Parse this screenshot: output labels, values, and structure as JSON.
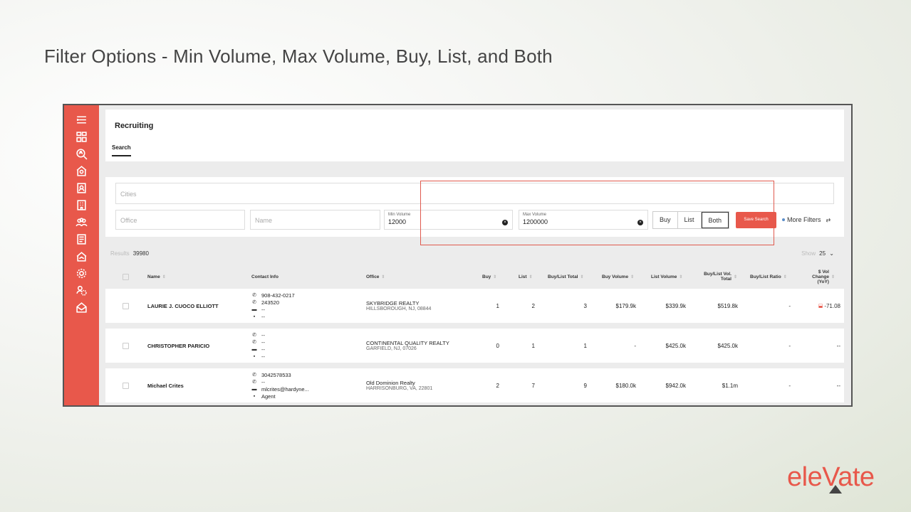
{
  "slide_title": "Filter Options - Min Volume, Max Volume, Buy, List, and Both",
  "sidebar": {
    "icons": [
      "menu-icon",
      "dashboard-icon",
      "search-people-icon",
      "office-search-icon",
      "contact-card-icon",
      "building-icon",
      "team-icon",
      "document-icon",
      "house-icon",
      "settings-icon",
      "people-settings-icon",
      "mail-icon"
    ]
  },
  "header": {
    "title": "Recruiting",
    "tab": "Search"
  },
  "filters": {
    "cities_placeholder": "Cities",
    "office_placeholder": "Office",
    "name_placeholder": "Name",
    "min_volume": {
      "label": "Min Volume",
      "value": "12000"
    },
    "max_volume": {
      "label": "Max Volume",
      "value": "1200000"
    },
    "toggle": {
      "buy": "Buy",
      "list": "List",
      "both": "Both",
      "active": "Both"
    },
    "save_search": "Save Search",
    "more_filters": "More Filters"
  },
  "results": {
    "label": "Results",
    "count": "39980",
    "show_label": "Show",
    "show_value": "25"
  },
  "columns": [
    "Name",
    "Contact Info",
    "Office",
    "Buy",
    "List",
    "Buy/List Total",
    "Buy Volume",
    "List Volume",
    "Buy/List Vol. Total",
    "Buy/List Ratio",
    "$ Vol Change (YoY)"
  ],
  "rows": [
    {
      "name": "LAURIE J. CUOCO ELLIOTT",
      "contact": [
        "908-432-0217",
        "243520",
        "--",
        "--"
      ],
      "office": "SKYBRIDGE REALTY",
      "address": "HILLSBOROUGH, NJ, 08844",
      "buy": "1",
      "list": "2",
      "total": "3",
      "buy_volume": "$179.9k",
      "list_volume": "$339.9k",
      "vol_total": "$519.8k",
      "ratio": "-",
      "change": "-71.08"
    },
    {
      "name": "CHRISTOPHER PARICIO",
      "contact": [
        "--",
        "--",
        "--",
        "--"
      ],
      "office": "CONTINENTAL QUALITY REALTY",
      "address": "GARFIELD, NJ, 07026",
      "buy": "0",
      "list": "1",
      "total": "1",
      "buy_volume": "-",
      "list_volume": "$425.0k",
      "vol_total": "$425.0k",
      "ratio": "-",
      "change": "--"
    },
    {
      "name": "Michael Crites",
      "contact": [
        "3042578533",
        "--",
        "mlcrites@hardyne...",
        "Agent"
      ],
      "office": "Old Dominion Realty",
      "address": "HARRISONBURG, VA, 22801",
      "buy": "2",
      "list": "7",
      "total": "9",
      "buy_volume": "$180.0k",
      "list_volume": "$942.0k",
      "vol_total": "$1.1m",
      "ratio": "-",
      "change": "--"
    }
  ],
  "logo": "eleVate",
  "colors": {
    "brand": "#e8584b",
    "highlight": "#e05a4e"
  }
}
